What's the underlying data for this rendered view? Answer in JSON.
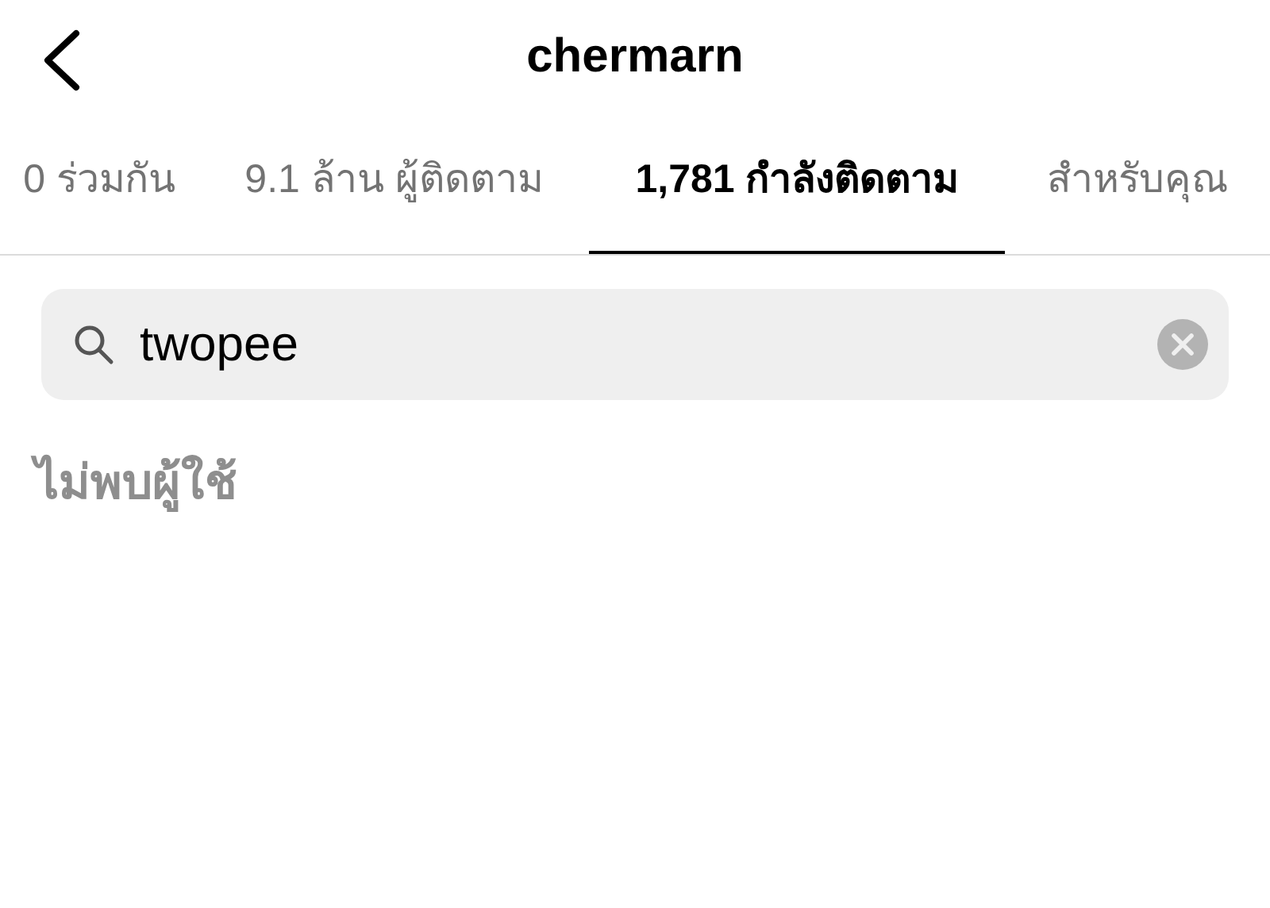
{
  "header": {
    "title": "chermarn"
  },
  "tabs": [
    {
      "label": "0 ร่วมกัน",
      "selected": false
    },
    {
      "label": "9.1 ล้าน ผู้ติดตาม",
      "selected": false
    },
    {
      "label": "1,781 กำลังติดตาม",
      "selected": true
    },
    {
      "label": "สำหรับคุณ",
      "selected": false
    }
  ],
  "search": {
    "value": "twopee"
  },
  "message": "ไม่พบผู้ใช้"
}
